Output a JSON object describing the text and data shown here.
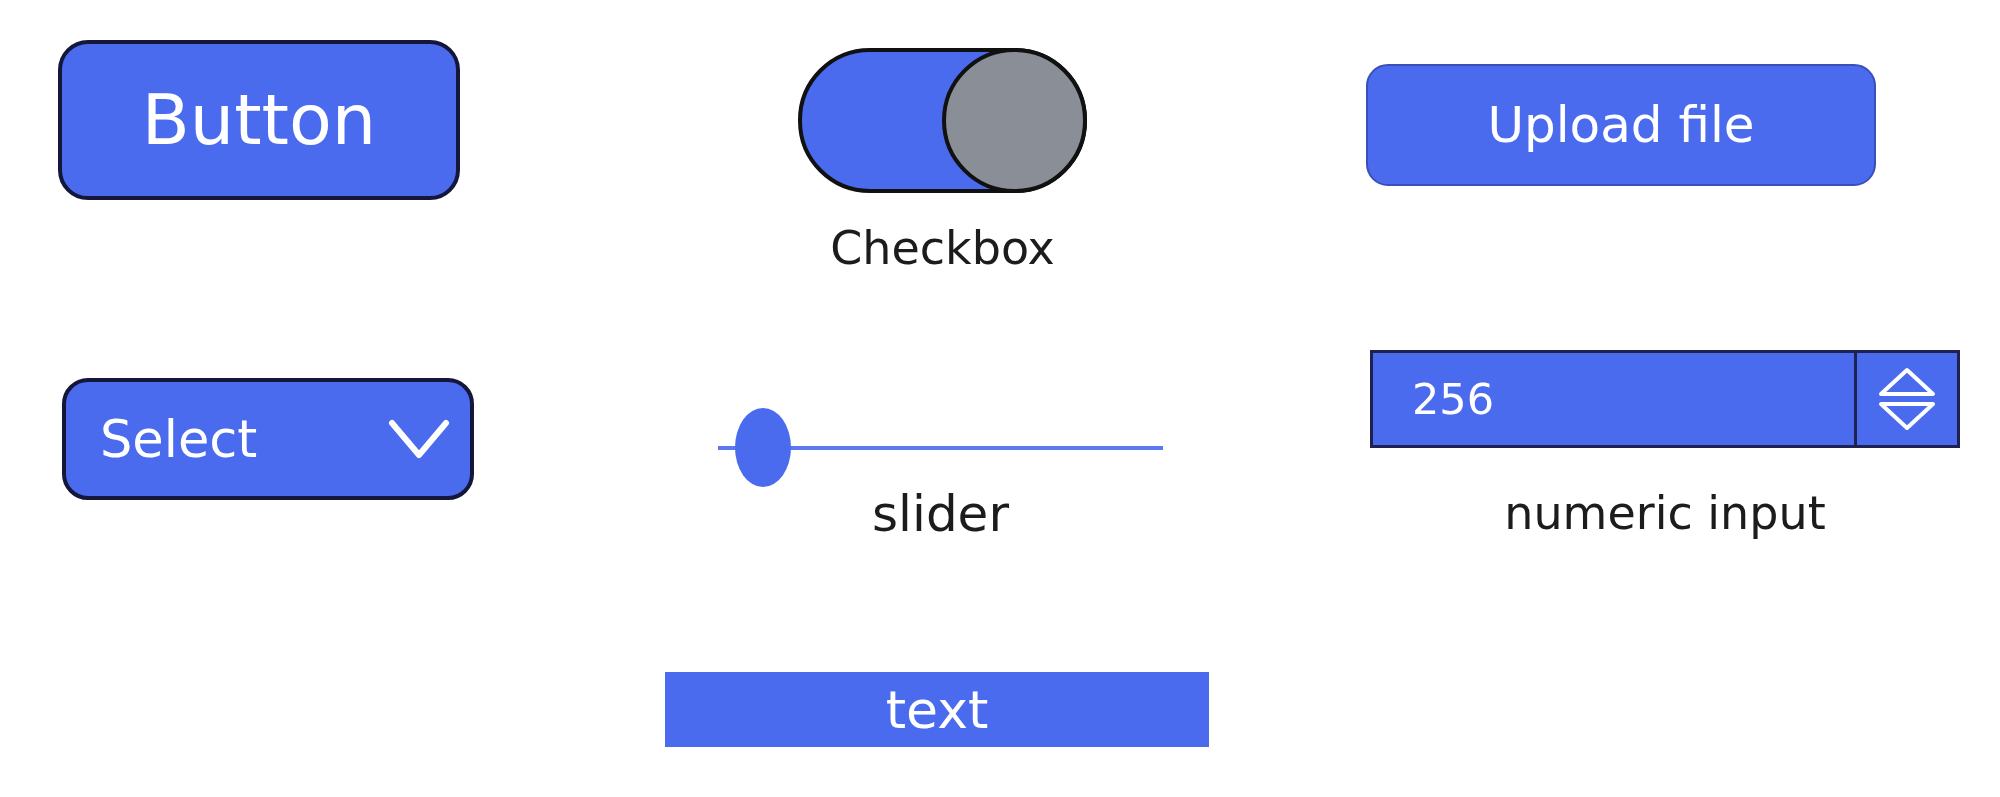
{
  "button": {
    "label": "Button"
  },
  "toggle": {
    "label": "Checkbox",
    "on": true
  },
  "upload_button": {
    "label": "Upload file"
  },
  "select": {
    "label": "Select"
  },
  "slider": {
    "level": 0.1,
    "label": "slider"
  },
  "numeric_input": {
    "value": "256",
    "label": "numeric input"
  },
  "text_input": {
    "value": "text"
  }
}
